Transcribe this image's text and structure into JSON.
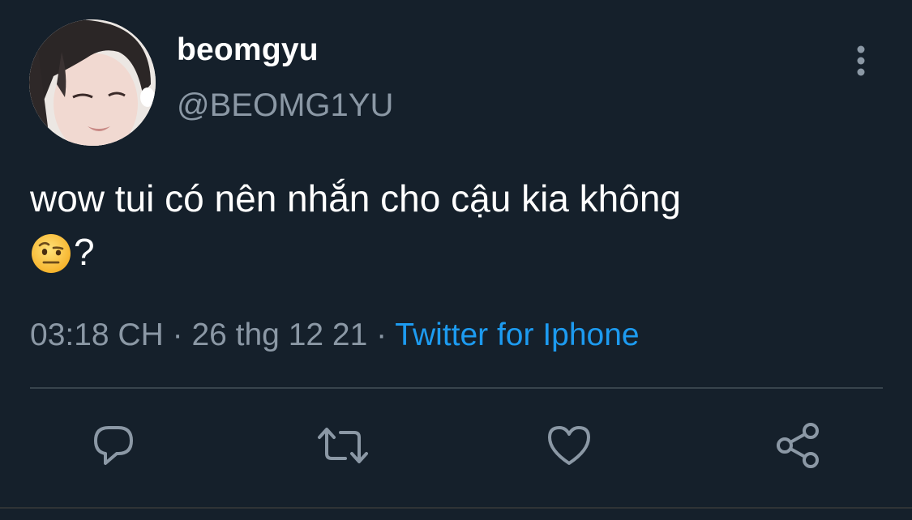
{
  "author": {
    "display_name": "beomgyu",
    "handle": "@BEOMG1YU"
  },
  "tweet": {
    "text_line1": "wow tui có nên nhắn cho cậu kia không",
    "text_line2_suffix": "?",
    "emoji": "face-with-raised-eyebrow"
  },
  "meta": {
    "time": "03:18 CH",
    "separator": " · ",
    "date": "26 thg 12 21",
    "source": "Twitter for Iphone"
  },
  "actions": [
    "reply-icon",
    "retweet-icon",
    "like-icon",
    "share-icon"
  ],
  "colors": {
    "background": "#15202b",
    "text": "#ffffff",
    "secondary": "#8b98a5",
    "link": "#1d9bf0",
    "divider": "#38444d"
  }
}
